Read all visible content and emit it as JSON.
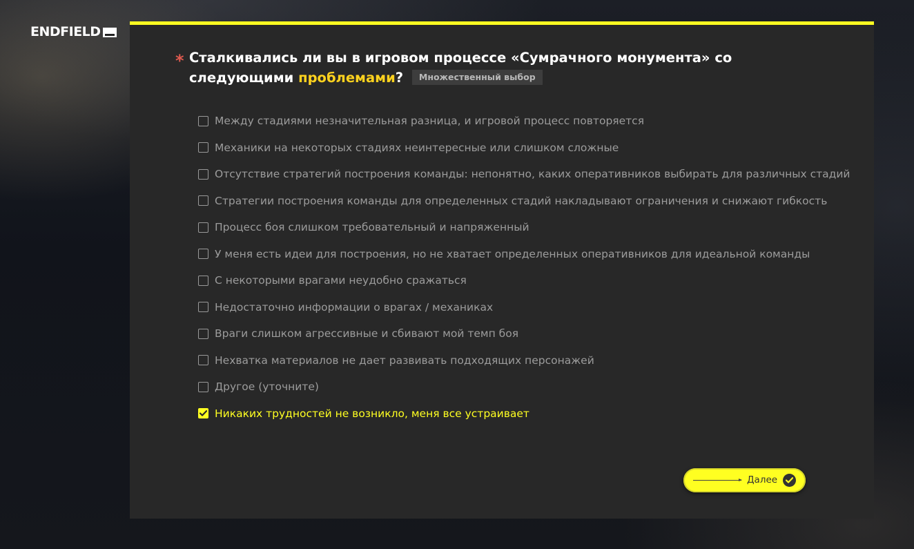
{
  "brand": {
    "logo_text": "ENDFIELD"
  },
  "question": {
    "text_before": "Сталкивались ли вы в игровом процессе «Сумрачного монумента» со следующими ",
    "text_highlight": "проблемами",
    "text_after": "?",
    "required_mark": "*",
    "tag": "Множественный выбор"
  },
  "options": [
    {
      "label": "Между стадиями незначительная разница, и игровой процесс повторяется",
      "checked": false
    },
    {
      "label": "Механики на некоторых стадиях неинтересные или слишком сложные",
      "checked": false
    },
    {
      "label": "Отсутствие стратегий построения команды: непонятно, каких оперативников выбирать для различных стадий",
      "checked": false
    },
    {
      "label": "Стратегии построения команды для определенных стадий накладывают ограничения и снижают гибкость",
      "checked": false
    },
    {
      "label": "Процесс боя слишком требовательный и напряженный",
      "checked": false
    },
    {
      "label": "У меня есть идеи для построения, но не хватает определенных оперативников для идеальной команды",
      "checked": false
    },
    {
      "label": "С некоторыми врагами неудобно сражаться",
      "checked": false
    },
    {
      "label": "Недостаточно информации о врагах / механиках",
      "checked": false
    },
    {
      "label": "Враги слишком агрессивные и сбивают мой темп боя",
      "checked": false
    },
    {
      "label": "Нехватка материалов не дает развивать подходящих персонажей",
      "checked": false
    },
    {
      "label": "Другое (уточните)",
      "checked": false
    },
    {
      "label": "Никаких трудностей не возникло, меня все устраивает",
      "checked": true
    }
  ],
  "next_button": {
    "label": "Далее",
    "icon": "check-circle-icon"
  },
  "colors": {
    "accent": "#ffff21",
    "highlight": "#ffd21e",
    "required": "#e05a4f",
    "panel": "#282828"
  }
}
